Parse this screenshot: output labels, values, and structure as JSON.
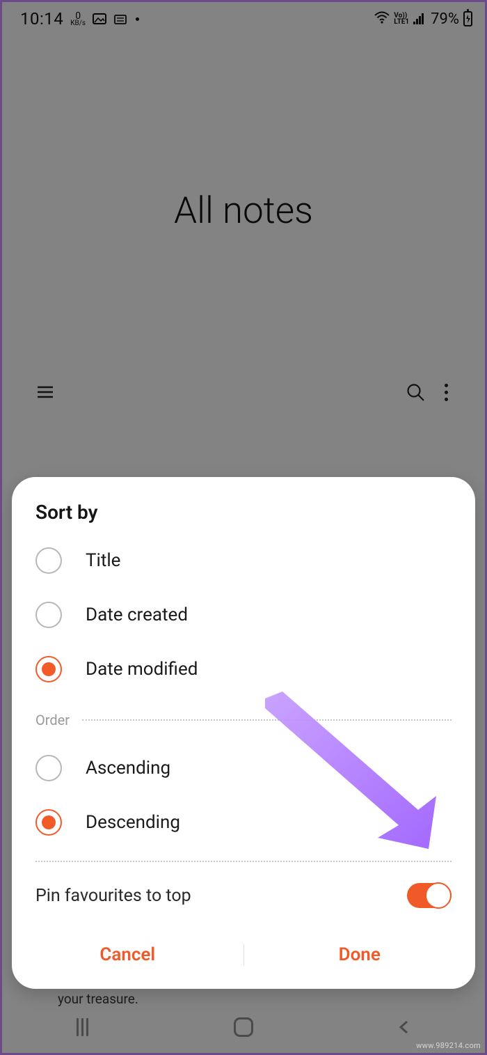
{
  "status": {
    "time": "10:14",
    "data_rate_value": "0",
    "data_rate_unit": "KB/s",
    "battery_pct": "79%"
  },
  "page": {
    "title": "All notes",
    "note_snippet": "your treasure."
  },
  "dialog": {
    "title": "Sort by",
    "sort_options": [
      {
        "label": "Title",
        "checked": false
      },
      {
        "label": "Date created",
        "checked": false
      },
      {
        "label": "Date modified",
        "checked": true
      }
    ],
    "order_section_label": "Order",
    "order_options": [
      {
        "label": "Ascending",
        "checked": false
      },
      {
        "label": "Descending",
        "checked": true
      }
    ],
    "pin_label": "Pin favourites to top",
    "pin_enabled": true,
    "cancel_label": "Cancel",
    "done_label": "Done"
  },
  "watermark": "www.989214.com"
}
